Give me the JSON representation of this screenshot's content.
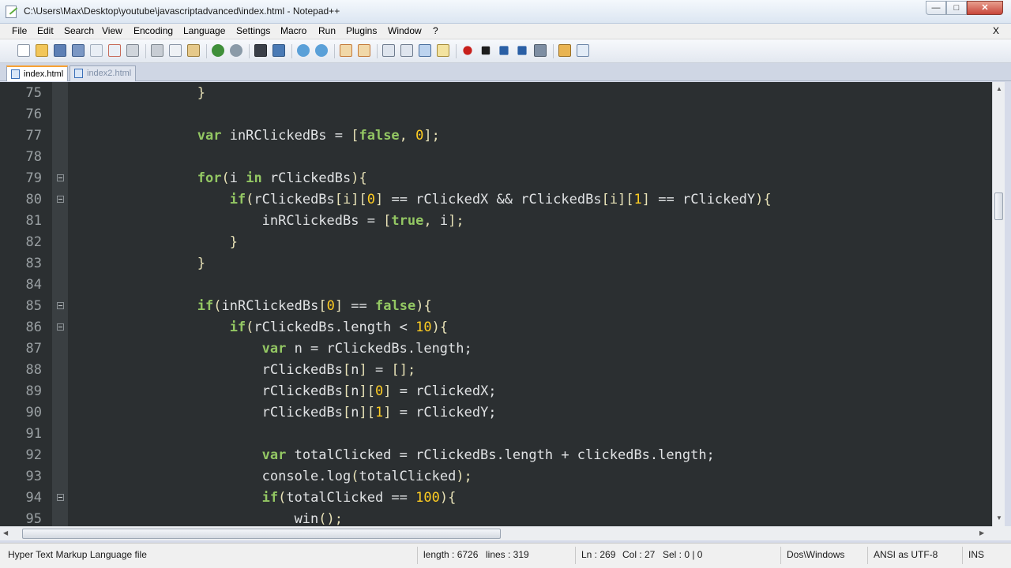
{
  "window": {
    "title": "C:\\Users\\Max\\Desktop\\youtube\\javascriptadvanced\\index.html - Notepad++",
    "minimize_glyph": "—",
    "maximize_glyph": "□",
    "close_glyph": "✕"
  },
  "menu": {
    "items": [
      "File",
      "Edit",
      "Search",
      "View",
      "Encoding",
      "Language",
      "Settings",
      "Macro",
      "Run",
      "Plugins",
      "Window",
      "?"
    ],
    "close_doc": "X"
  },
  "toolbar": {
    "icons": [
      "new-file-icon",
      "open-file-icon",
      "save-icon",
      "save-all-icon",
      "close-icon",
      "close-all-icon",
      "print-icon",
      "cut-icon",
      "copy-icon",
      "paste-icon",
      "undo-icon",
      "redo-icon",
      "find-icon",
      "replace-icon",
      "zoom-in-icon",
      "zoom-out-icon",
      "sync-vertical-icon",
      "sync-horizontal-icon",
      "word-wrap-icon",
      "show-all-characters-icon",
      "indent-guide-icon",
      "language-icon",
      "record-macro-icon",
      "stop-record-icon",
      "play-macro-icon",
      "run-macro-multiple-icon",
      "save-macro-icon",
      "launch-browser-icon",
      "spell-check-icon"
    ]
  },
  "tabs": [
    {
      "label": "index.html",
      "active": true
    },
    {
      "label": "index2.html",
      "active": false
    }
  ],
  "editor": {
    "lines": [
      {
        "num": "75",
        "fold": false,
        "tokens": [
          [
            "p",
            "                }"
          ]
        ]
      },
      {
        "num": "76",
        "fold": false,
        "tokens": []
      },
      {
        "num": "77",
        "fold": false,
        "tokens": [
          [
            "k",
            "                var"
          ],
          [
            "t",
            " inRClickedBs = "
          ],
          [
            "p",
            "["
          ],
          [
            "k",
            "false"
          ],
          [
            "p",
            ", "
          ],
          [
            "n",
            "0"
          ],
          [
            "p",
            "];"
          ]
        ]
      },
      {
        "num": "78",
        "fold": false,
        "tokens": []
      },
      {
        "num": "79",
        "fold": true,
        "tokens": [
          [
            "k",
            "                for"
          ],
          [
            "p",
            "("
          ],
          [
            "t",
            "i "
          ],
          [
            "k",
            "in"
          ],
          [
            "t",
            " rClickedBs"
          ],
          [
            "p",
            "){"
          ]
        ]
      },
      {
        "num": "80",
        "fold": true,
        "tokens": [
          [
            "k",
            "                    if"
          ],
          [
            "p",
            "("
          ],
          [
            "t",
            "rClickedBs"
          ],
          [
            "p",
            "[i]["
          ],
          [
            "n",
            "0"
          ],
          [
            "p",
            "]"
          ],
          [
            "t",
            " == rClickedX && rClickedBs"
          ],
          [
            "p",
            "[i]["
          ],
          [
            "n",
            "1"
          ],
          [
            "p",
            "]"
          ],
          [
            "t",
            " == rClickedY"
          ],
          [
            "p",
            "){"
          ]
        ]
      },
      {
        "num": "81",
        "fold": false,
        "tokens": [
          [
            "t",
            "                        inRClickedBs = "
          ],
          [
            "p",
            "["
          ],
          [
            "k",
            "true"
          ],
          [
            "p",
            ", "
          ],
          [
            "t",
            "i"
          ],
          [
            "p",
            "];"
          ]
        ]
      },
      {
        "num": "82",
        "fold": false,
        "tokens": [
          [
            "p",
            "                    }"
          ]
        ]
      },
      {
        "num": "83",
        "fold": false,
        "tokens": [
          [
            "p",
            "                }"
          ]
        ]
      },
      {
        "num": "84",
        "fold": false,
        "tokens": []
      },
      {
        "num": "85",
        "fold": true,
        "tokens": [
          [
            "k",
            "                if"
          ],
          [
            "p",
            "("
          ],
          [
            "t",
            "inRClickedBs"
          ],
          [
            "p",
            "["
          ],
          [
            "n",
            "0"
          ],
          [
            "p",
            "]"
          ],
          [
            "t",
            " == "
          ],
          [
            "k",
            "false"
          ],
          [
            "p",
            "){"
          ]
        ]
      },
      {
        "num": "86",
        "fold": true,
        "tokens": [
          [
            "k",
            "                    if"
          ],
          [
            "p",
            "("
          ],
          [
            "t",
            "rClickedBs.length < "
          ],
          [
            "n",
            "10"
          ],
          [
            "p",
            "){"
          ]
        ]
      },
      {
        "num": "87",
        "fold": false,
        "tokens": [
          [
            "k",
            "                        var"
          ],
          [
            "t",
            " n = rClickedBs.length;"
          ]
        ]
      },
      {
        "num": "88",
        "fold": false,
        "tokens": [
          [
            "t",
            "                        rClickedBs"
          ],
          [
            "p",
            "["
          ],
          [
            "t",
            "n"
          ],
          [
            "p",
            "]"
          ],
          [
            "t",
            " = "
          ],
          [
            "p",
            "[];"
          ]
        ]
      },
      {
        "num": "89",
        "fold": false,
        "tokens": [
          [
            "t",
            "                        rClickedBs"
          ],
          [
            "p",
            "["
          ],
          [
            "t",
            "n"
          ],
          [
            "p",
            "]["
          ],
          [
            "n",
            "0"
          ],
          [
            "p",
            "]"
          ],
          [
            "t",
            " = rClickedX;"
          ]
        ]
      },
      {
        "num": "90",
        "fold": false,
        "tokens": [
          [
            "t",
            "                        rClickedBs"
          ],
          [
            "p",
            "["
          ],
          [
            "t",
            "n"
          ],
          [
            "p",
            "]["
          ],
          [
            "n",
            "1"
          ],
          [
            "p",
            "]"
          ],
          [
            "t",
            " = rClickedY;"
          ]
        ]
      },
      {
        "num": "91",
        "fold": false,
        "tokens": []
      },
      {
        "num": "92",
        "fold": false,
        "tokens": [
          [
            "k",
            "                        var"
          ],
          [
            "t",
            " totalClicked = rClickedBs.length + clickedBs.length;"
          ]
        ]
      },
      {
        "num": "93",
        "fold": false,
        "tokens": [
          [
            "t",
            "                        console.log"
          ],
          [
            "p",
            "("
          ],
          [
            "t",
            "totalClicked"
          ],
          [
            "p",
            ");"
          ]
        ]
      },
      {
        "num": "94",
        "fold": true,
        "tokens": [
          [
            "k",
            "                        if"
          ],
          [
            "p",
            "("
          ],
          [
            "t",
            "totalClicked == "
          ],
          [
            "n",
            "100"
          ],
          [
            "p",
            "){"
          ]
        ]
      },
      {
        "num": "95",
        "fold": false,
        "tokens": [
          [
            "t",
            "                            win"
          ],
          [
            "p",
            "();"
          ]
        ]
      }
    ]
  },
  "status": {
    "file_type": "Hyper Text Markup Language file",
    "length": "length : 6726",
    "lines": "lines : 319",
    "ln": "Ln : 269",
    "col": "Col : 27",
    "sel": "Sel : 0 | 0",
    "eol": "Dos\\Windows",
    "encoding": "ANSI as UTF-8",
    "mode": "INS"
  },
  "colors": {
    "editor_bg": "#2b2f31",
    "keyword": "#93c763",
    "number": "#ffcd22",
    "operator": "#e8e2b7",
    "text": "#e0e2e4",
    "line_number": "#9aa0a3"
  }
}
